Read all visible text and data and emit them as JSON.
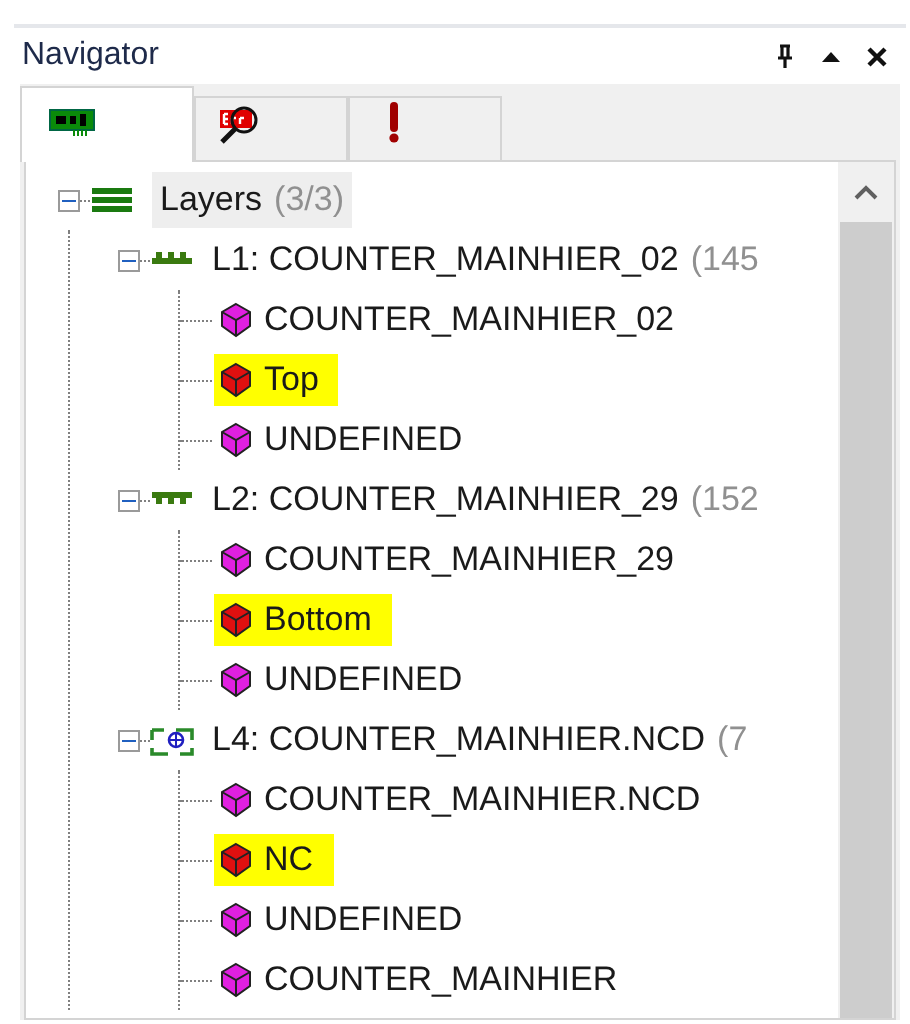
{
  "panel": {
    "title": "Navigator",
    "buttons": [
      {
        "kind": "pin"
      },
      {
        "kind": "maximize"
      },
      {
        "kind": "close"
      }
    ]
  },
  "tabs": [
    {
      "kind": "board",
      "selected": true
    },
    {
      "kind": "errors",
      "selected": false
    },
    {
      "kind": "warnings",
      "selected": false
    }
  ],
  "tree": {
    "label": "Layers",
    "count": "(3/3)",
    "expanded": true,
    "selected": true,
    "children": [
      {
        "kind": "top",
        "label": "L1: COUNTER_MAINHIER_02",
        "count": "(145",
        "expanded": true,
        "children": [
          {
            "label": "COUNTER_MAINHIER_02",
            "color": "#e020e0",
            "highlighted": false
          },
          {
            "label": "Top",
            "color": "#e01010",
            "highlighted": true
          },
          {
            "label": "UNDEFINED",
            "color": "#e020e0",
            "highlighted": false
          }
        ]
      },
      {
        "kind": "bottom",
        "label": "L2: COUNTER_MAINHIER_29",
        "count": "(152",
        "expanded": true,
        "children": [
          {
            "label": "COUNTER_MAINHIER_29",
            "color": "#e020e0",
            "highlighted": false
          },
          {
            "label": "Bottom",
            "color": "#e01010",
            "highlighted": true
          },
          {
            "label": "UNDEFINED",
            "color": "#e020e0",
            "highlighted": false
          }
        ]
      },
      {
        "kind": "ncd",
        "label": "L4: COUNTER_MAINHIER.NCD",
        "count": "(7",
        "expanded": true,
        "children": [
          {
            "label": "COUNTER_MAINHIER.NCD",
            "color": "#e020e0",
            "highlighted": false
          },
          {
            "label": "NC",
            "color": "#e01010",
            "highlighted": true
          },
          {
            "label": "UNDEFINED",
            "color": "#e020e0",
            "highlighted": false
          },
          {
            "label": "COUNTER_MAINHIER",
            "color": "#e020e0",
            "highlighted": false
          }
        ]
      }
    ]
  }
}
